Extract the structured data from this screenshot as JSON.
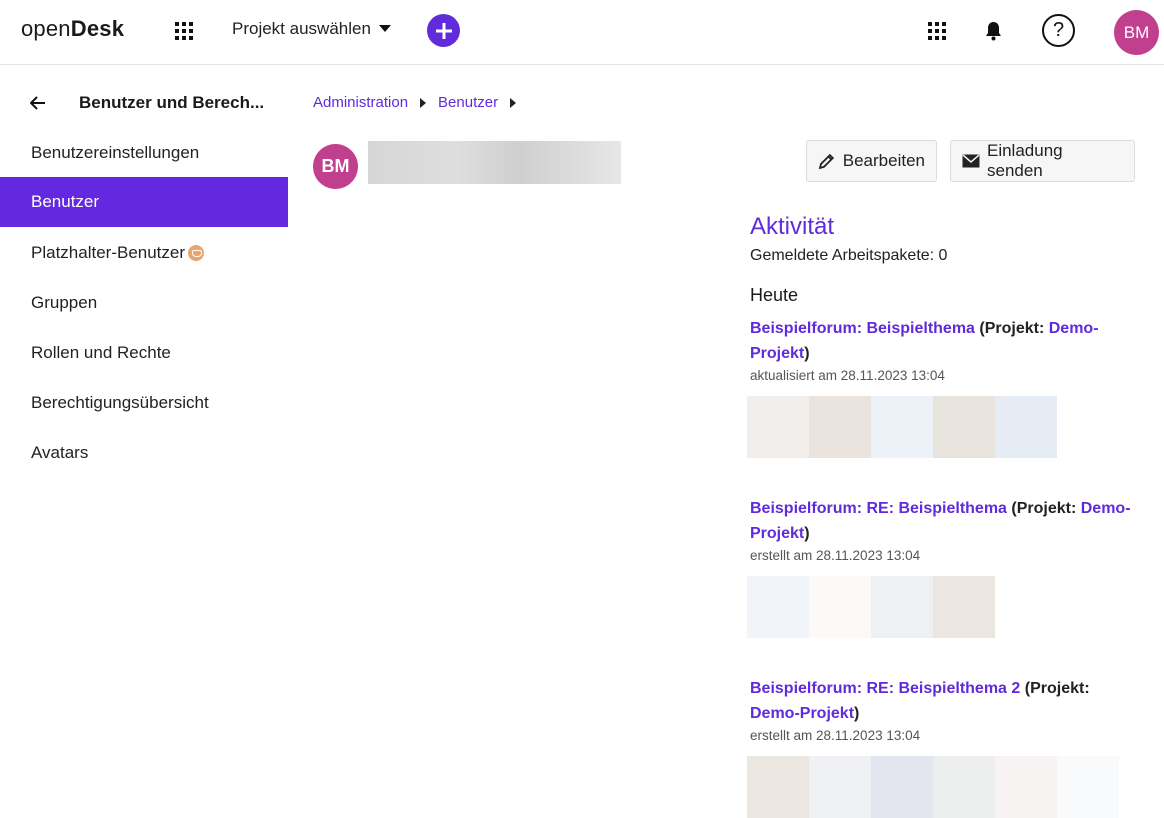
{
  "header": {
    "logo_light": "open",
    "logo_bold": "Desk",
    "project_select": "Projekt auswählen",
    "plus_label": "+",
    "help_label": "?",
    "avatar_initials": "BM"
  },
  "sidebar": {
    "title": "Benutzer und Berech...",
    "items": [
      {
        "label": "Benutzereinstellungen"
      },
      {
        "label": "Benutzer"
      },
      {
        "label": "Platzhalter-Benutzer"
      },
      {
        "label": "Gruppen"
      },
      {
        "label": "Rollen und Rechte"
      },
      {
        "label": "Berechtigungsübersicht"
      },
      {
        "label": "Avatars"
      }
    ]
  },
  "breadcrumb": [
    "Administration",
    "Benutzer"
  ],
  "user": {
    "initials": "BM"
  },
  "buttons": {
    "edit": "Bearbeiten",
    "invite": "Einladung senden"
  },
  "activity": {
    "title": "Aktivität",
    "reported": "Gemeldete Arbeitspakete: 0",
    "day": "Heute",
    "entries": [
      {
        "link": "Beispielforum: Beispielthema",
        "project_prefix": " (Projekt: ",
        "project_link": "Demo-Projekt",
        "suffix": ")",
        "meta": "aktualisiert am 28.11.2023 13:04",
        "thumbs": [
          "#f2eeec",
          "#ebe3de",
          "#edf2f9",
          "#e9e3dd",
          "#e6ecf3"
        ]
      },
      {
        "link": "Beispielforum: RE: Beispielthema",
        "project_prefix": " (Projekt: ",
        "project_link": "Demo-Projekt",
        "suffix": ")",
        "meta": "erstellt am 28.11.2023 13:04",
        "thumbs": [
          "#f1f5f9",
          "#fbfaf6",
          "#eef1f4",
          "#ebe6df"
        ]
      },
      {
        "link": "Beispielforum: RE: Beispielthema 2",
        "project_prefix": " (Projekt: ",
        "project_link": "Demo-Projekt",
        "suffix": ")",
        "meta": "erstellt am 28.11.2023 13:04",
        "thumbs": [
          "#ece6e0",
          "#eff1f5",
          "#e3e5ef",
          "#eceeee",
          "#f7f3f2",
          "#f8fafc"
        ]
      }
    ]
  },
  "colors": {
    "accent": "#5f2bdb",
    "active_bg": "#6328e0",
    "avatar": "#c0408f"
  }
}
